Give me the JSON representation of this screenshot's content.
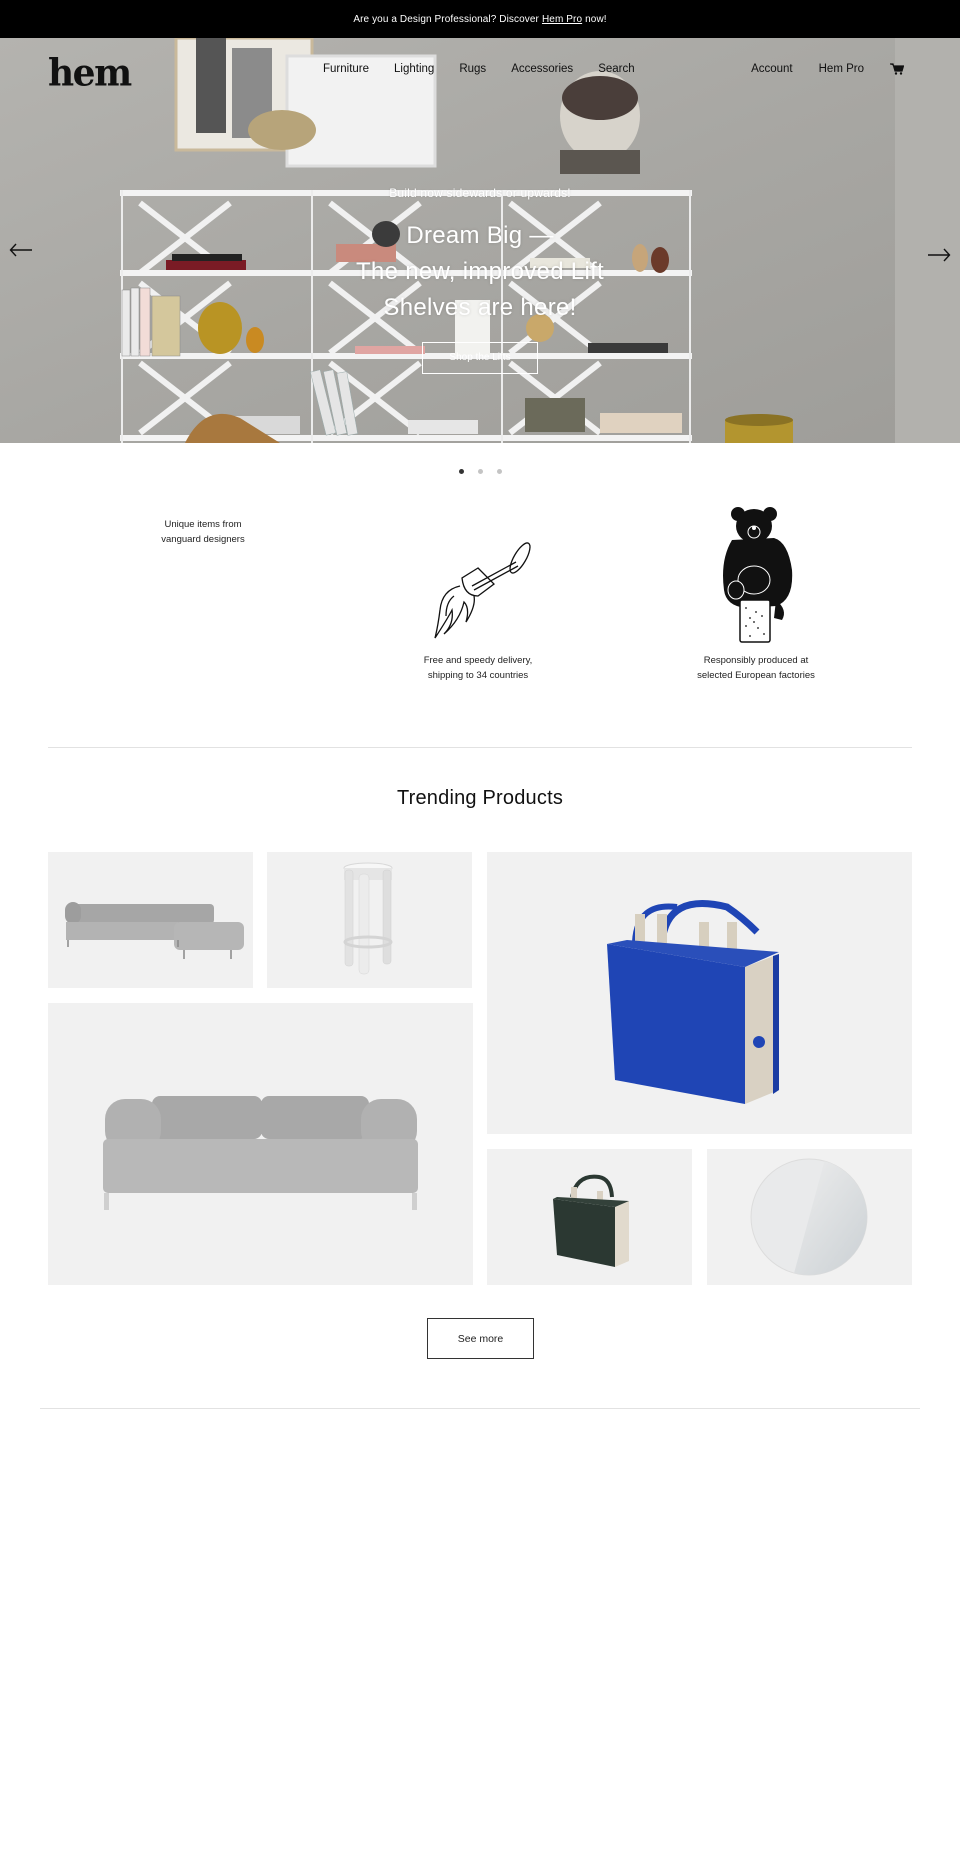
{
  "announcement": {
    "prefix": "Are you a Design Professional? Discover",
    "link": "Hem Pro",
    "suffix": "now!"
  },
  "header": {
    "logo": "hem",
    "nav": [
      "Furniture",
      "Lighting",
      "Rugs",
      "Accessories",
      "Search"
    ],
    "account": "Account",
    "pro": "Hem Pro",
    "cart_icon": "cart-icon"
  },
  "hero": {
    "eyebrow": "Build now sidewards or upwards!",
    "title_lines": [
      "Dream Big —",
      "The new, improved Lift",
      "Shelves are here!"
    ],
    "cta": "Shop the Lifts",
    "prev_icon": "arrow-left-icon",
    "next_icon": "arrow-right-icon",
    "slides_total": 3,
    "slide_active": 1
  },
  "features": [
    {
      "line1": "Unique items from",
      "line2": "vanguard designers",
      "icon": "none"
    },
    {
      "line1": "Free and speedy delivery,",
      "line2": "shipping to 34 countries",
      "icon": "rocket-lamp-icon"
    },
    {
      "line1": "Responsibly produced at",
      "line2": "selected European factories",
      "icon": "bear-icon"
    }
  ],
  "trending": {
    "title": "Trending Products",
    "products": [
      {
        "name": "corner-sofa",
        "icon": "corner-sofa-image"
      },
      {
        "name": "bar-stool",
        "icon": "bar-stool-image"
      },
      {
        "name": "blue-tote-bag",
        "icon": "blue-bag-image"
      },
      {
        "name": "grey-sofa",
        "icon": "sofa-image"
      },
      {
        "name": "green-tote-bag",
        "icon": "green-bag-image"
      },
      {
        "name": "round-mirror",
        "icon": "mirror-image"
      }
    ],
    "see_more": "See more"
  },
  "colors": {
    "announcement_bg": "#000000",
    "tile_bg": "#f1f1f1",
    "bag_blue": "#1f45b5",
    "bag_green": "#2b3832"
  }
}
